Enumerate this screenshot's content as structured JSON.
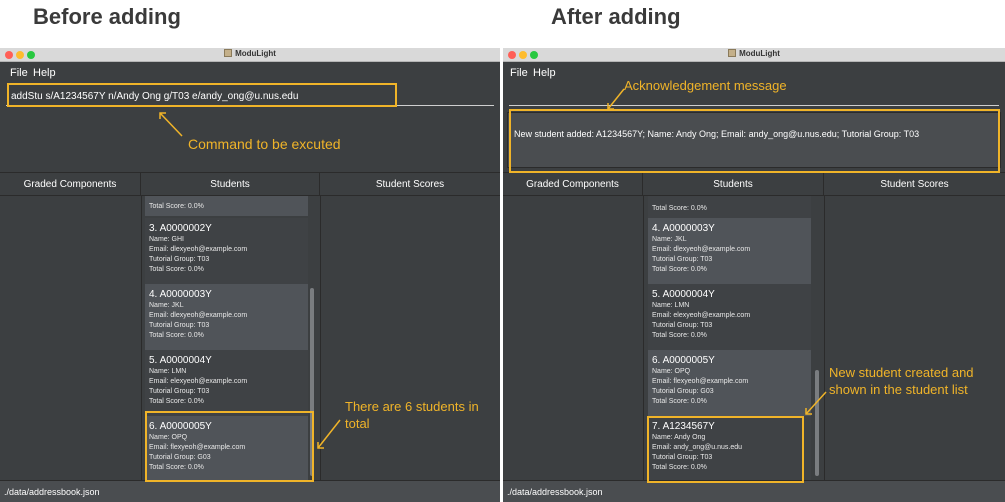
{
  "headings": {
    "before": "Before adding",
    "after": "After adding"
  },
  "window": {
    "title": "ModuLight"
  },
  "menu": {
    "file": "File",
    "help": "Help"
  },
  "before": {
    "command": "addStu s/A1234567Y n/Andy Ong g/T03 e/andy_ong@u.nus.edu",
    "panels": {
      "graded": "Graded Components",
      "students": "Students",
      "scores": "Student Scores"
    },
    "partial_card": "Total Score: 0.0%",
    "students": [
      {
        "title": "3.  A0000002Y",
        "name": "Name: GHI",
        "email": "Email: dlexyeoh@example.com",
        "group": "Tutorial Group: T03",
        "score": "Total Score: 0.0%"
      },
      {
        "title": "4.  A0000003Y",
        "name": "Name: JKL",
        "email": "Email: dlexyeoh@example.com",
        "group": "Tutorial Group: T03",
        "score": "Total Score: 0.0%"
      },
      {
        "title": "5.  A0000004Y",
        "name": "Name: LMN",
        "email": "Email: elexyeoh@example.com",
        "group": "Tutorial Group: T03",
        "score": "Total Score: 0.0%"
      },
      {
        "title": "6.  A0000005Y",
        "name": "Name: OPQ",
        "email": "Email: flexyeoh@example.com",
        "group": "Tutorial Group: G03",
        "score": "Total Score: 0.0%"
      }
    ],
    "status": "./data/addressbook.json",
    "annotations": {
      "command": "Command to be excuted",
      "total": "There are 6 students in total"
    }
  },
  "after": {
    "result": "New student added: A1234567Y; Name: Andy Ong; Email: andy_ong@u.nus.edu; Tutorial Group: T03",
    "panels": {
      "graded": "Graded Components",
      "students": "Students",
      "scores": "Student Scores"
    },
    "partial_card": "Total Score: 0.0%",
    "students": [
      {
        "title": "4.  A0000003Y",
        "name": "Name: JKL",
        "email": "Email: dlexyeoh@example.com",
        "group": "Tutorial Group: T03",
        "score": "Total Score: 0.0%"
      },
      {
        "title": "5.  A0000004Y",
        "name": "Name: LMN",
        "email": "Email: elexyeoh@example.com",
        "group": "Tutorial Group: T03",
        "score": "Total Score: 0.0%"
      },
      {
        "title": "6.  A0000005Y",
        "name": "Name: OPQ",
        "email": "Email: flexyeoh@example.com",
        "group": "Tutorial Group: G03",
        "score": "Total Score: 0.0%"
      },
      {
        "title": "7.  A1234567Y",
        "name": "Name: Andy Ong",
        "email": "Email: andy_ong@u.nus.edu",
        "group": "Tutorial Group: T03",
        "score": "Total Score: 0.0%"
      }
    ],
    "status": "./data/addressbook.json",
    "annotations": {
      "ack": "Acknowledgement message",
      "new_student": "New student created and shown in the student list"
    }
  },
  "colors": {
    "highlight": "#f0b429",
    "window_bg": "#3c3f41",
    "card_dark": "#505459",
    "card_light": "#3f4245"
  },
  "icons": {
    "close": "close-icon",
    "minimize": "minimize-icon",
    "zoom": "zoom-icon",
    "app": "app-icon"
  }
}
